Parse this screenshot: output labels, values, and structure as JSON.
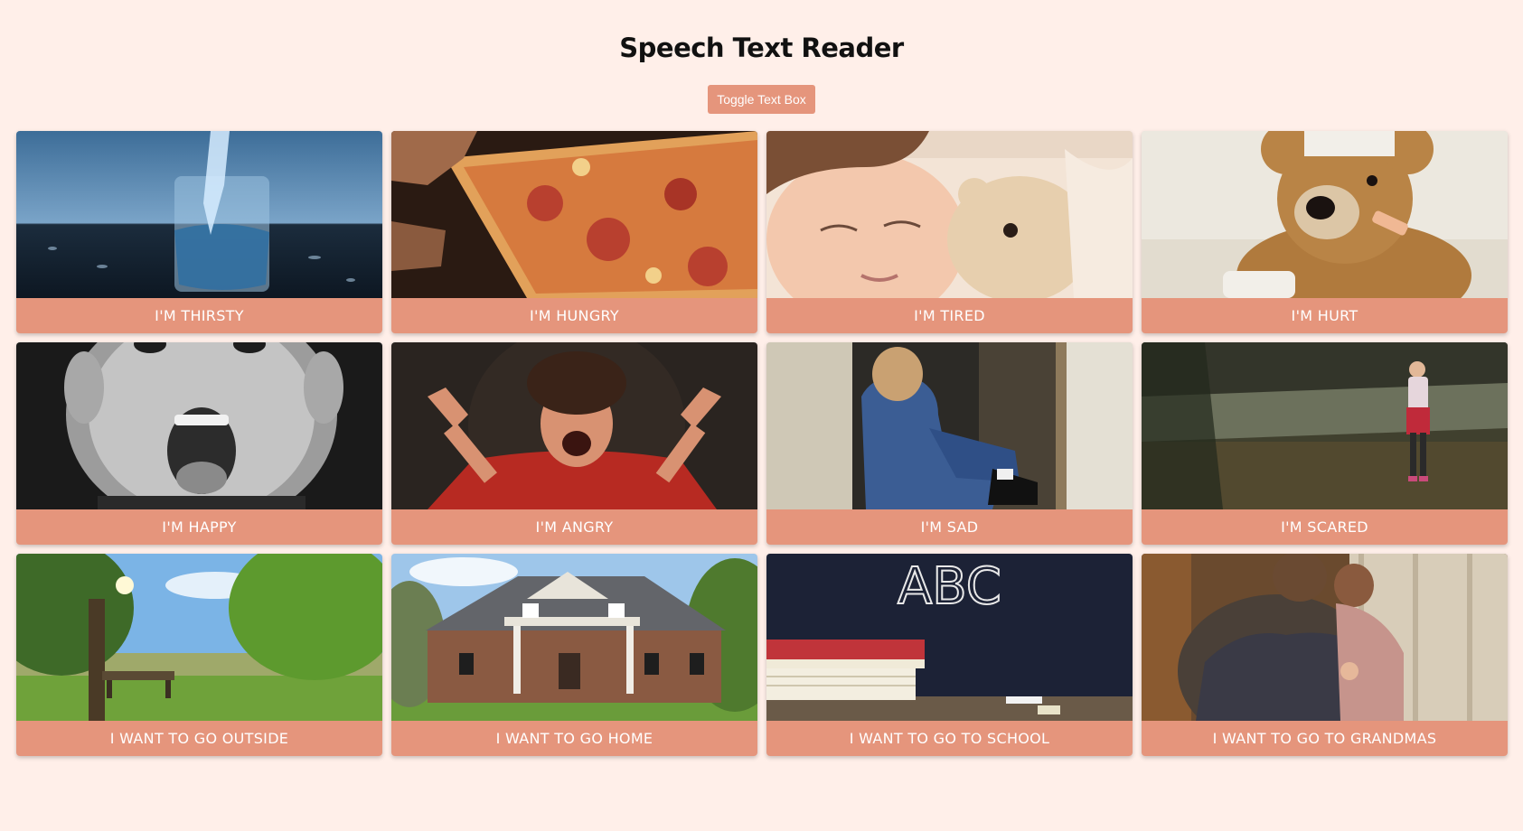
{
  "header": {
    "title": "Speech Text Reader",
    "toggle_label": "Toggle Text Box"
  },
  "cards": [
    {
      "label": "I'M THIRSTY",
      "image": "glass-of-water"
    },
    {
      "label": "I'M HUNGRY",
      "image": "pizza-slice"
    },
    {
      "label": "I'M TIRED",
      "image": "sleeping-child-with-teddy"
    },
    {
      "label": "I'M HURT",
      "image": "bandaged-teddy-bear"
    },
    {
      "label": "I'M HAPPY",
      "image": "happy-boy-face"
    },
    {
      "label": "I'M ANGRY",
      "image": "angry-child"
    },
    {
      "label": "I'M SAD",
      "image": "sad-child-in-doorway"
    },
    {
      "label": "I'M SCARED",
      "image": "small-girl-in-field"
    },
    {
      "label": "I WANT TO GO OUTSIDE",
      "image": "park-with-bench"
    },
    {
      "label": "I WANT TO GO HOME",
      "image": "brick-house"
    },
    {
      "label": "I WANT TO GO TO SCHOOL",
      "image": "books-and-chalkboard",
      "image_text": "ABC"
    },
    {
      "label": "I WANT TO GO TO GRANDMAS",
      "image": "grandma-with-child"
    }
  ]
}
